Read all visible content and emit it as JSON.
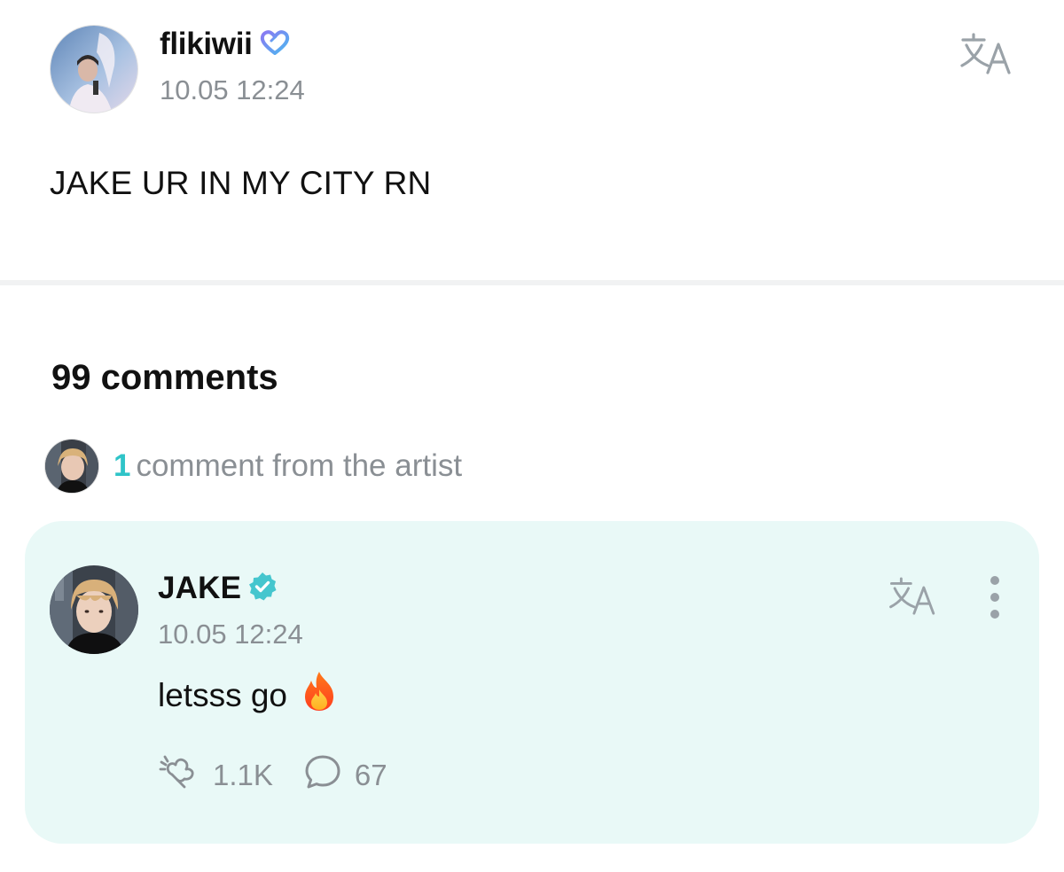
{
  "post": {
    "author": "flikiwii",
    "badge_icon": "heart-outline-icon",
    "timestamp": "10.05 12:24",
    "body": "JAKE UR IN MY CITY RN",
    "translate_icon": "translate-icon"
  },
  "comments": {
    "count_label": "99 comments",
    "artist_count": "1",
    "artist_label": "comment from the artist"
  },
  "artist_comment": {
    "author": "JAKE",
    "verified_icon": "verified-badge-icon",
    "timestamp": "10.05 12:24",
    "text": "letsss go",
    "emoji": "🔥",
    "likes": "1.1K",
    "replies": "67"
  },
  "colors": {
    "accent": "#2fc4c8",
    "card_bg": "#e9f9f7",
    "muted_text": "#8a8f94",
    "divider": "#f1f2f3"
  }
}
